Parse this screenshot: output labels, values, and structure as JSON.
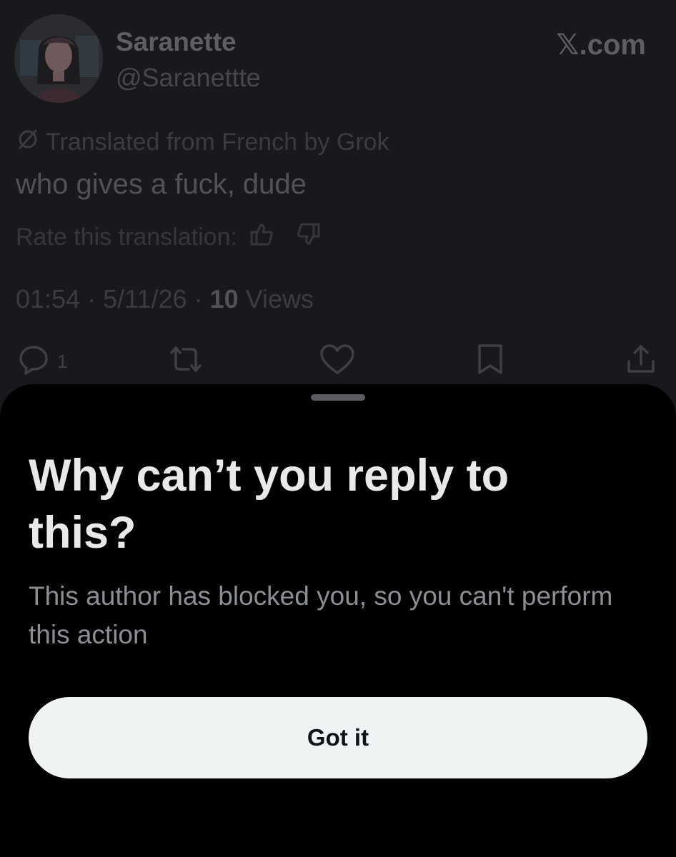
{
  "tweet": {
    "display_name": "Saranette",
    "handle": "@Saranettte",
    "site_logo": "𝕏.com",
    "translated_label": "Translated from French by Grok",
    "text": "who gives a fuck, dude",
    "rate_label": "Rate this translation:",
    "time": "01:54",
    "date": "5/11/26",
    "views_count": "10",
    "views_label": "Views",
    "separator": "·",
    "reply_count": "1",
    "icons": [
      "translate-icon",
      "thumbs-up-icon",
      "thumbs-down-icon",
      "reply-icon",
      "retweet-icon",
      "like-icon",
      "bookmark-icon",
      "share-icon"
    ]
  },
  "sheet": {
    "title": "Why can’t you reply to this?",
    "body": "This author has blocked you, so you can't perform this action",
    "button_label": "Got it"
  },
  "colors": {
    "sheet_background": "#000000",
    "dimmed_background": "#18191c",
    "button_background": "#eff3f4",
    "title_color": "#e7e9ea",
    "body_color": "#8b8f94"
  }
}
